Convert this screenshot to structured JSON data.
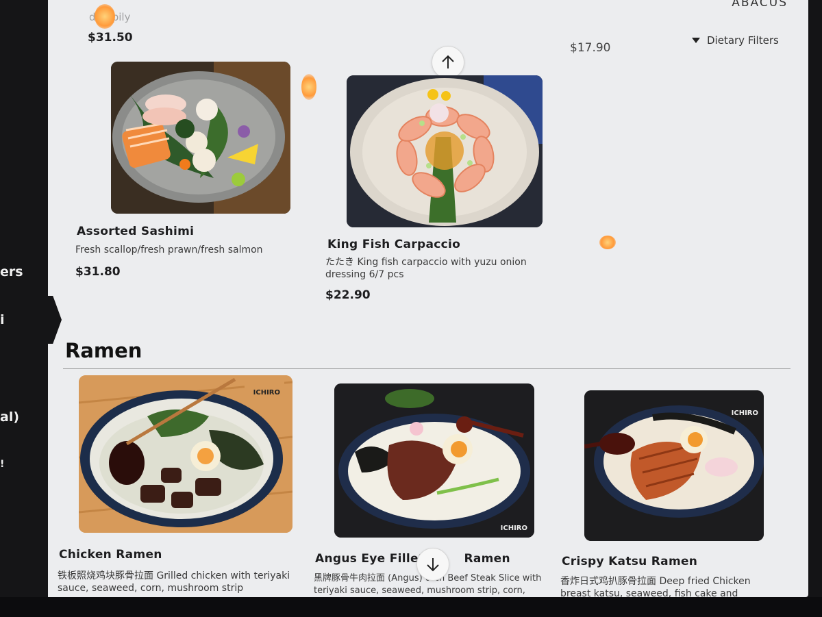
{
  "brand": "ABACUS",
  "filters_label": "Dietary Filters",
  "top_strip": {
    "cut_text": "dill&pily",
    "price_left": "$31.50",
    "price_right": "$17.90"
  },
  "sidebar": {
    "labels": [
      "ers",
      "i",
      "al)",
      "!"
    ]
  },
  "items_top": [
    {
      "title": "Assorted Sashimi",
      "desc": "Fresh scallop/fresh prawn/fresh salmon",
      "price": "$31.80",
      "image_icon": "sashimi-plate-photo"
    },
    {
      "title": "King Fish Carpaccio",
      "desc": "たたき King fish carpaccio with yuzu onion dressing 6/7 pcs",
      "price": "$22.90",
      "image_icon": "carpaccio-plate-photo"
    }
  ],
  "section": {
    "title": "Ramen"
  },
  "ramen_items": [
    {
      "title": "Chicken Ramen",
      "desc": "铁板照烧鸡块豚骨拉面 Grilled chicken with teriyaki sauce, seaweed, corn, mushroom strip",
      "image_icon": "chicken-ramen-photo",
      "logo_text": "ICHIRO"
    },
    {
      "title": "Angus Eye Fillet",
      "title_tail": "Ramen",
      "desc": "黑牌豚骨牛肉拉面 (Angus)  otch Beef Steak Slice with teriyaki sauce, seaweed, mushroom strip, corn,",
      "image_icon": "angus-ramen-photo",
      "logo_text": "ICHIRO"
    },
    {
      "title": "Crispy Katsu Ramen",
      "desc": "香炸日式鸡扒豚骨拉面 Deep fried Chicken breast katsu, seaweed, fish cake and",
      "image_icon": "katsu-ramen-photo",
      "logo_text": "ICHIRO"
    }
  ],
  "icons": {
    "scroll_up": "arrow-up-icon",
    "scroll_down": "arrow-down-icon",
    "filter": "triangle-down-icon"
  }
}
